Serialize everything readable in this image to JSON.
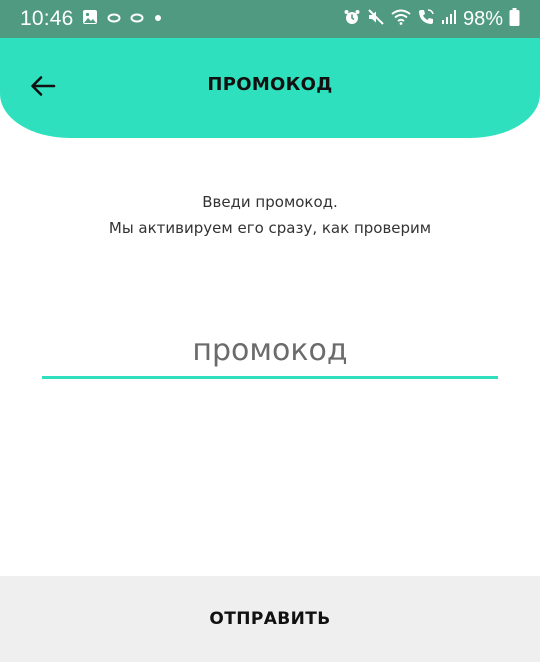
{
  "status_bar": {
    "time": "10:46",
    "battery": "98%",
    "left_icons": [
      "gallery-icon",
      "ring-icon",
      "ring-icon",
      "dot-icon"
    ],
    "right_icons": [
      "alarm-icon",
      "mute-icon",
      "wifi-icon",
      "wifi-calling-icon",
      "signal-icon",
      "battery-icon"
    ]
  },
  "header": {
    "title": "ПРОМОКОД",
    "back_icon": "arrow-left-icon"
  },
  "instructions": {
    "line1": "Введи промокод.",
    "line2": "Мы активируем его сразу, как проверим"
  },
  "promo_field": {
    "placeholder": "промокод",
    "value": ""
  },
  "submit": {
    "label": "ОТПРАВИТЬ"
  },
  "colors": {
    "accent": "#2ee0bd",
    "status_bar": "#4f9a80",
    "footer_button": "#efefef"
  }
}
